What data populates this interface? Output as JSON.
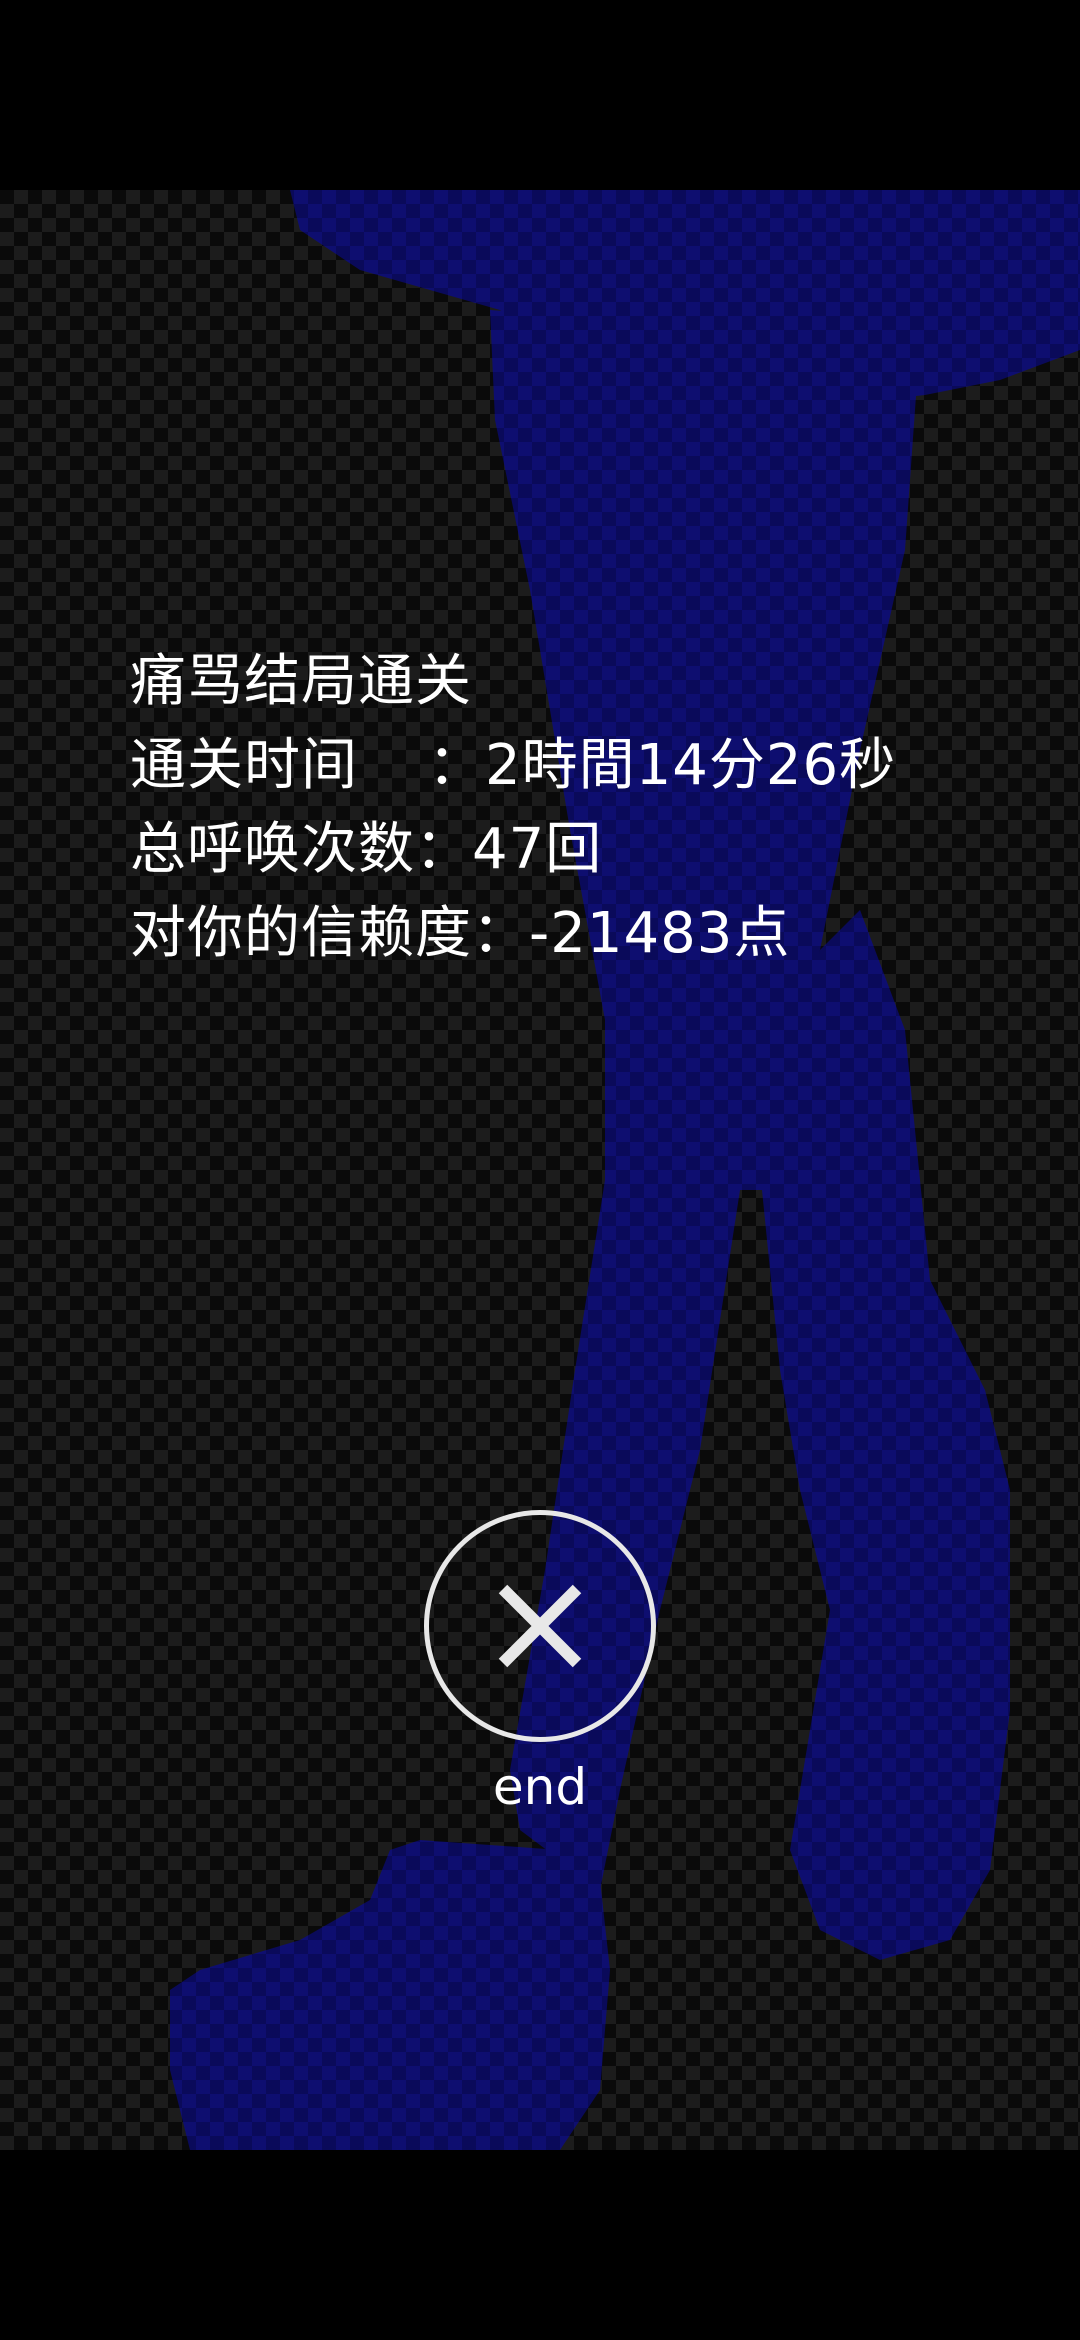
{
  "result": {
    "line1": "痛骂结局通关",
    "line2_label": "通关时间",
    "line2_value": "：2時間14分26秒",
    "line3": "总呼唤次数：47回",
    "line4": "对你的信赖度：-21483点"
  },
  "end_button": {
    "label": "end",
    "icon": "close-icon"
  },
  "colors": {
    "silhouette": "#0d0d6b",
    "text": "#ffffff",
    "background": "#000000"
  }
}
